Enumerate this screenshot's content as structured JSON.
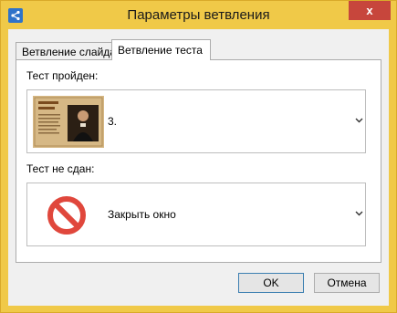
{
  "window": {
    "title": "Параметры ветвления",
    "close_glyph": "x"
  },
  "tabs": [
    {
      "label": "Ветвление слайда",
      "selected": false
    },
    {
      "label": "Ветвление теста",
      "selected": true
    }
  ],
  "passed": {
    "label": "Тест пройден:",
    "selected_value": "3.",
    "icon": "slide-thumbnail"
  },
  "failed": {
    "label": "Тест не сдан:",
    "selected_value": "Закрыть окно",
    "icon": "no-entry-icon"
  },
  "buttons": {
    "ok": "OK",
    "cancel": "Отмена"
  },
  "colors": {
    "frame": "#f0c948",
    "close": "#c7463c",
    "stop": "#e0473c"
  }
}
